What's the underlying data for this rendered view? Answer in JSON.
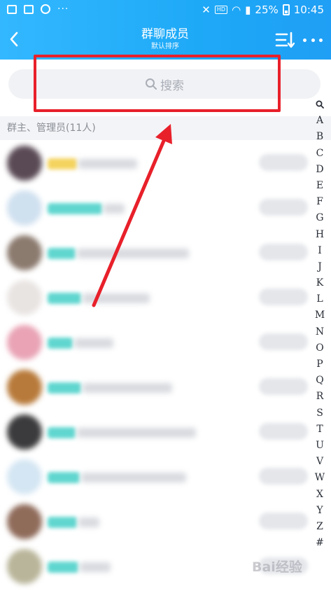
{
  "status_bar": {
    "left_dots": "···",
    "hd": "HD",
    "battery": "25%",
    "time": "10:45"
  },
  "app_bar": {
    "title": "群聊成员",
    "subtitle": "默认排序"
  },
  "search": {
    "placeholder": "搜索"
  },
  "group_header": "群主、管理员(11人)",
  "members": [
    {
      "avatar_color": "#5a4a55",
      "tag_color": "#f4d35e",
      "tag_w": 42,
      "name_w": 84
    },
    {
      "avatar_color": "#cfe0ef",
      "tag_color": "#5fd6cf",
      "tag_w": 78,
      "name_w": 30
    },
    {
      "avatar_color": "#8b7a6e",
      "tag_color": "#5fd6cf",
      "tag_w": 40,
      "name_w": 160
    },
    {
      "avatar_color": "#e8e4e2",
      "tag_color": "#5fd6cf",
      "tag_w": 48,
      "name_w": 96
    },
    {
      "avatar_color": "#e9a3b5",
      "tag_color": "#5fd6cf",
      "tag_w": 36,
      "name_w": 56
    },
    {
      "avatar_color": "#b87a3a",
      "tag_color": "#5fd6cf",
      "tag_w": 48,
      "name_w": 128
    },
    {
      "avatar_color": "#3b3a3c",
      "tag_color": "#5fd6cf",
      "tag_w": 40,
      "name_w": 170
    },
    {
      "avatar_color": "#d4e6f3",
      "tag_color": "#5fd6cf",
      "tag_w": 46,
      "name_w": 150
    },
    {
      "avatar_color": "#8f6b5a",
      "tag_color": "#5fd6cf",
      "tag_w": 42,
      "name_w": 30
    },
    {
      "avatar_color": "#b9b59a",
      "tag_color": "#5fd6cf",
      "tag_w": 44,
      "name_w": 44
    }
  ],
  "index_letters": [
    "A",
    "B",
    "C",
    "D",
    "E",
    "F",
    "G",
    "H",
    "I",
    "J",
    "K",
    "L",
    "M",
    "N",
    "O",
    "P",
    "Q",
    "R",
    "S",
    "T",
    "U",
    "V",
    "W",
    "X",
    "Y",
    "Z",
    "#"
  ],
  "watermark": "Bai经验",
  "colors": {
    "header": "#1ea9f7",
    "highlight": "#e8202a"
  }
}
